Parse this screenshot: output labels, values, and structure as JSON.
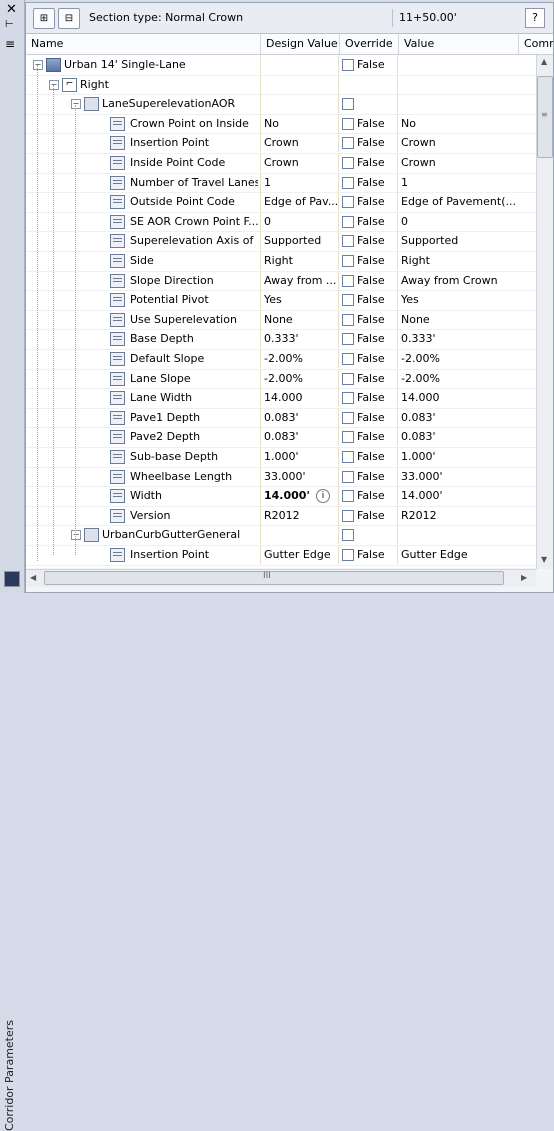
{
  "palette": {
    "title": "Corridor Parameters",
    "close_glyph": "✕",
    "pin_glyph": "⊢",
    "menu_glyph": "≡"
  },
  "toolbar": {
    "section_label": "Section type:  Normal Crown",
    "station": "11+50.00'",
    "help_label": "?"
  },
  "columns": [
    "Name",
    "Design Value",
    "Override",
    "Value",
    "Comment"
  ],
  "rows": [
    {
      "name": "Urban 14' Single-Lane",
      "level": 0,
      "kind": "assembly",
      "expand": "−",
      "design": "",
      "override": true,
      "ov": "False",
      "value": ""
    },
    {
      "name": "Right",
      "level": 1,
      "kind": "side",
      "expand": "−",
      "design": "",
      "override": false,
      "ov": "",
      "value": ""
    },
    {
      "name": "LaneSuperelevationAOR",
      "level": 2,
      "kind": "subassembly",
      "expand": "−",
      "design": "",
      "override": true,
      "ov": "",
      "value": ""
    },
    {
      "name": "Crown Point on Inside",
      "level": 3,
      "kind": "param",
      "design": "No",
      "override": true,
      "ov": "False",
      "value": "No"
    },
    {
      "name": "Insertion Point",
      "level": 3,
      "kind": "param",
      "design": "Crown",
      "override": true,
      "ov": "False",
      "value": "Crown"
    },
    {
      "name": "Inside Point Code",
      "level": 3,
      "kind": "param",
      "design": "Crown",
      "override": true,
      "ov": "False",
      "value": "Crown"
    },
    {
      "name": "Number of Travel Lanes",
      "level": 3,
      "kind": "param",
      "design": "1",
      "override": true,
      "ov": "False",
      "value": "1"
    },
    {
      "name": "Outside Point Code",
      "level": 3,
      "kind": "param",
      "design": "Edge of Pav...",
      "override": true,
      "ov": "False",
      "value": "Edge of Pavement(..."
    },
    {
      "name": "SE AOR Crown Point F...",
      "level": 3,
      "kind": "param",
      "design": "0",
      "override": true,
      "ov": "False",
      "value": "0"
    },
    {
      "name": "Superelevation Axis of ...",
      "level": 3,
      "kind": "param",
      "design": "Supported",
      "override": true,
      "ov": "False",
      "value": "Supported"
    },
    {
      "name": "Side",
      "level": 3,
      "kind": "param",
      "design": "Right",
      "override": true,
      "ov": "False",
      "value": "Right"
    },
    {
      "name": "Slope Direction",
      "level": 3,
      "kind": "param",
      "design": "Away from ...",
      "override": true,
      "ov": "False",
      "value": "Away from Crown"
    },
    {
      "name": "Potential Pivot",
      "level": 3,
      "kind": "param",
      "design": "Yes",
      "override": true,
      "ov": "False",
      "value": "Yes"
    },
    {
      "name": "Use Superelevation",
      "level": 3,
      "kind": "param",
      "design": "None",
      "override": true,
      "ov": "False",
      "value": "None"
    },
    {
      "name": "Base Depth",
      "level": 3,
      "kind": "param",
      "design": "0.333'",
      "override": true,
      "ov": "False",
      "value": "0.333'"
    },
    {
      "name": "Default Slope",
      "level": 3,
      "kind": "param",
      "design": "-2.00%",
      "override": true,
      "ov": "False",
      "value": "-2.00%"
    },
    {
      "name": "Lane Slope",
      "level": 3,
      "kind": "param",
      "design": "-2.00%",
      "override": true,
      "ov": "False",
      "value": "-2.00%"
    },
    {
      "name": "Lane Width",
      "level": 3,
      "kind": "param",
      "design": "14.000",
      "override": true,
      "ov": "False",
      "value": "14.000"
    },
    {
      "name": "Pave1 Depth",
      "level": 3,
      "kind": "param",
      "design": "0.083'",
      "override": true,
      "ov": "False",
      "value": "0.083'"
    },
    {
      "name": "Pave2 Depth",
      "level": 3,
      "kind": "param",
      "design": "0.083'",
      "override": true,
      "ov": "False",
      "value": "0.083'"
    },
    {
      "name": "Sub-base Depth",
      "level": 3,
      "kind": "param",
      "design": "1.000'",
      "override": true,
      "ov": "False",
      "value": "1.000'"
    },
    {
      "name": "Wheelbase Length",
      "level": 3,
      "kind": "param",
      "design": "33.000'",
      "override": true,
      "ov": "False",
      "value": "33.000'"
    },
    {
      "name": "Width",
      "level": 3,
      "kind": "param",
      "design": "14.000'",
      "bold": true,
      "info": true,
      "override": true,
      "ov": "False",
      "value": "14.000'"
    },
    {
      "name": "Version",
      "level": 3,
      "kind": "param",
      "design": "R2012",
      "override": true,
      "ov": "False",
      "value": "R2012"
    },
    {
      "name": "UrbanCurbGutterGeneral",
      "level": 2,
      "kind": "subassembly",
      "expand": "−",
      "design": "",
      "override": true,
      "ov": "",
      "value": ""
    },
    {
      "name": "Insertion Point",
      "level": 3,
      "kind": "param",
      "design": "Gutter Edge",
      "override": true,
      "ov": "False",
      "value": "Gutter Edge"
    }
  ],
  "scroll": {
    "h_thumb_glyph": "III",
    "v_grip": "≡"
  }
}
